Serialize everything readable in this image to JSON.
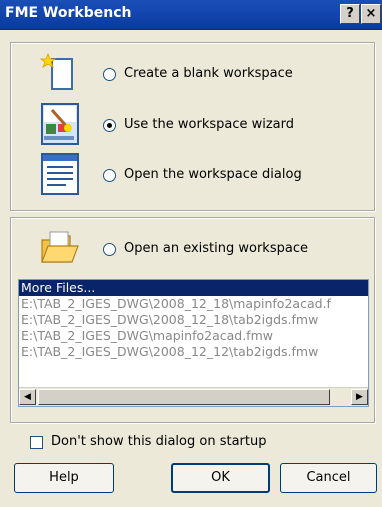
{
  "window": {
    "title": "FME Workbench",
    "help_glyph": "?",
    "close_glyph": "×"
  },
  "options": [
    {
      "label": "Create a blank workspace",
      "icon": "blank-document-icon",
      "checked": false
    },
    {
      "label": "Use the workspace wizard",
      "icon": "wizard-icon",
      "checked": true
    },
    {
      "label": "Open the workspace dialog",
      "icon": "workspace-dialog-icon",
      "checked": false
    }
  ],
  "existing": {
    "label": "Open an existing workspace",
    "icon": "open-folder-icon",
    "checked": false
  },
  "recent_files": [
    "More Files...",
    "E:\\TAB_2_IGES_DWG\\2008_12_18\\mapinfo2acad.f",
    "E:\\TAB_2_IGES_DWG\\2008_12_18\\tab2igds.fmw",
    "E:\\TAB_2_IGES_DWG\\mapinfo2acad.fmw",
    "E:\\TAB_2_IGES_DWG\\2008_12_12\\tab2igds.fmw"
  ],
  "selected_file_index": 0,
  "scrollbar": {
    "left_glyph": "◀",
    "right_glyph": "▶"
  },
  "startup_checkbox": {
    "label": "Don't show this dialog on startup",
    "checked": false
  },
  "buttons": {
    "help": "Help",
    "ok": "OK",
    "cancel": "Cancel"
  },
  "colors": {
    "title_bar": "#0a3aa0",
    "selection": "#0a246a",
    "dialog_bg": "#ece9d8"
  }
}
